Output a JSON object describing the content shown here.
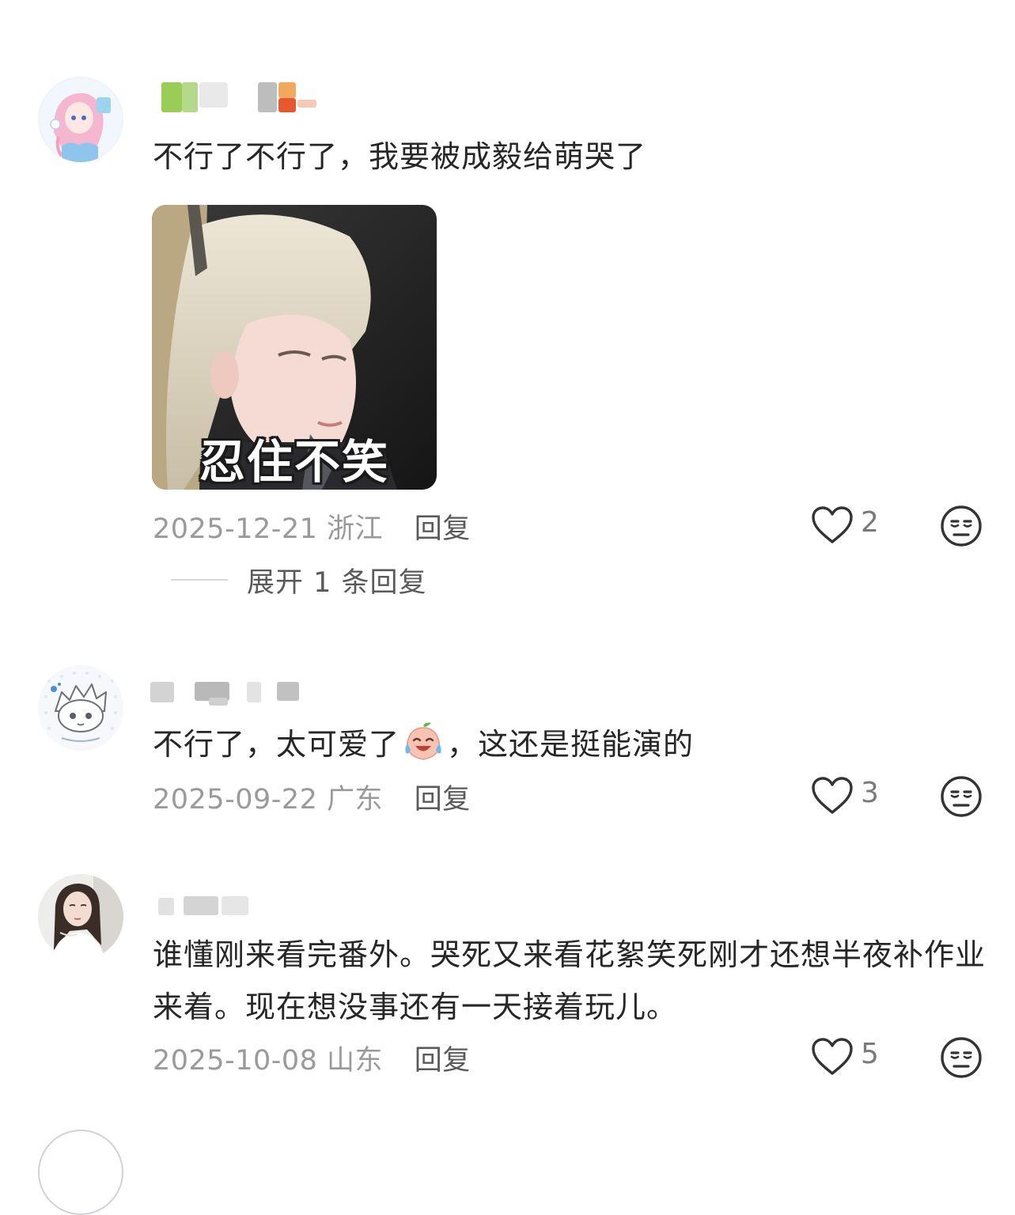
{
  "comments": [
    {
      "text": "不行了不行了，我要被成毅给萌哭了",
      "sticker_caption": "忍住不笑",
      "date": "2025-12-21",
      "location": "浙江",
      "reply_label": "回复",
      "likes": "2",
      "expand_label": "展开 1 条回复"
    },
    {
      "text_before": "不行了，太可爱了",
      "emoji": "crying-laughing-peach-emoji",
      "text_after": "，这还是挺能演的",
      "date": "2025-09-22",
      "location": "广东",
      "reply_label": "回复",
      "likes": "3"
    },
    {
      "text": "谁懂刚来看完番外。哭死又来看花絮笑死刚才还想半夜补作业来着。现在想没事还有一天接着玩儿。",
      "date": "2025-10-08",
      "location": "山东",
      "reply_label": "回复",
      "likes": "5"
    }
  ],
  "icons": {
    "like": "heart-outline-icon",
    "dislike": "unamused-face-icon"
  },
  "colors": {
    "meta_text": "#9a9a9a",
    "body_text": "#262626",
    "icon_stroke": "#333333"
  }
}
